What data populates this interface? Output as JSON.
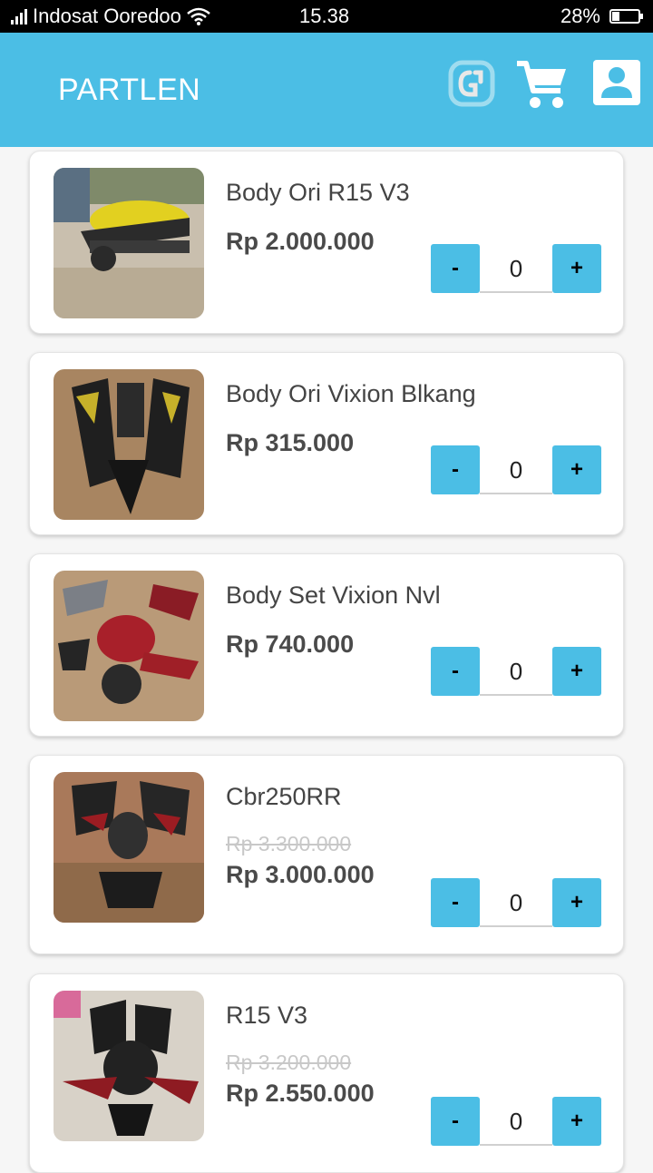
{
  "status_bar": {
    "carrier": "Indosat Ooredoo",
    "time": "15.38",
    "battery": "28%",
    "battery_level": 0.28
  },
  "app_bar": {
    "title": "PARTLEN",
    "icons": [
      "logo-icon",
      "cart-icon",
      "profile-icon"
    ]
  },
  "colors": {
    "accent": "#4bbee5",
    "card": "#ffffff",
    "background": "#f6f6f6"
  },
  "products": [
    {
      "name": "Body Ori R15 V3",
      "old_price": "",
      "price": "Rp 2.000.000",
      "qty": "0",
      "minus": "-",
      "plus": "+"
    },
    {
      "name": "Body Ori Vixion Blkang",
      "old_price": "",
      "price": "Rp 315.000",
      "qty": "0",
      "minus": "-",
      "plus": "+"
    },
    {
      "name": "Body Set Vixion Nvl",
      "old_price": "",
      "price": "Rp 740.000",
      "qty": "0",
      "minus": "-",
      "plus": "+"
    },
    {
      "name": "Cbr250RR",
      "old_price": "Rp 3.300.000",
      "price": "Rp 3.000.000",
      "qty": "0",
      "minus": "-",
      "plus": "+"
    },
    {
      "name": "R15 V3",
      "old_price": "Rp 3.200.000",
      "price": "Rp 2.550.000",
      "qty": "0",
      "minus": "-",
      "plus": "+"
    }
  ]
}
